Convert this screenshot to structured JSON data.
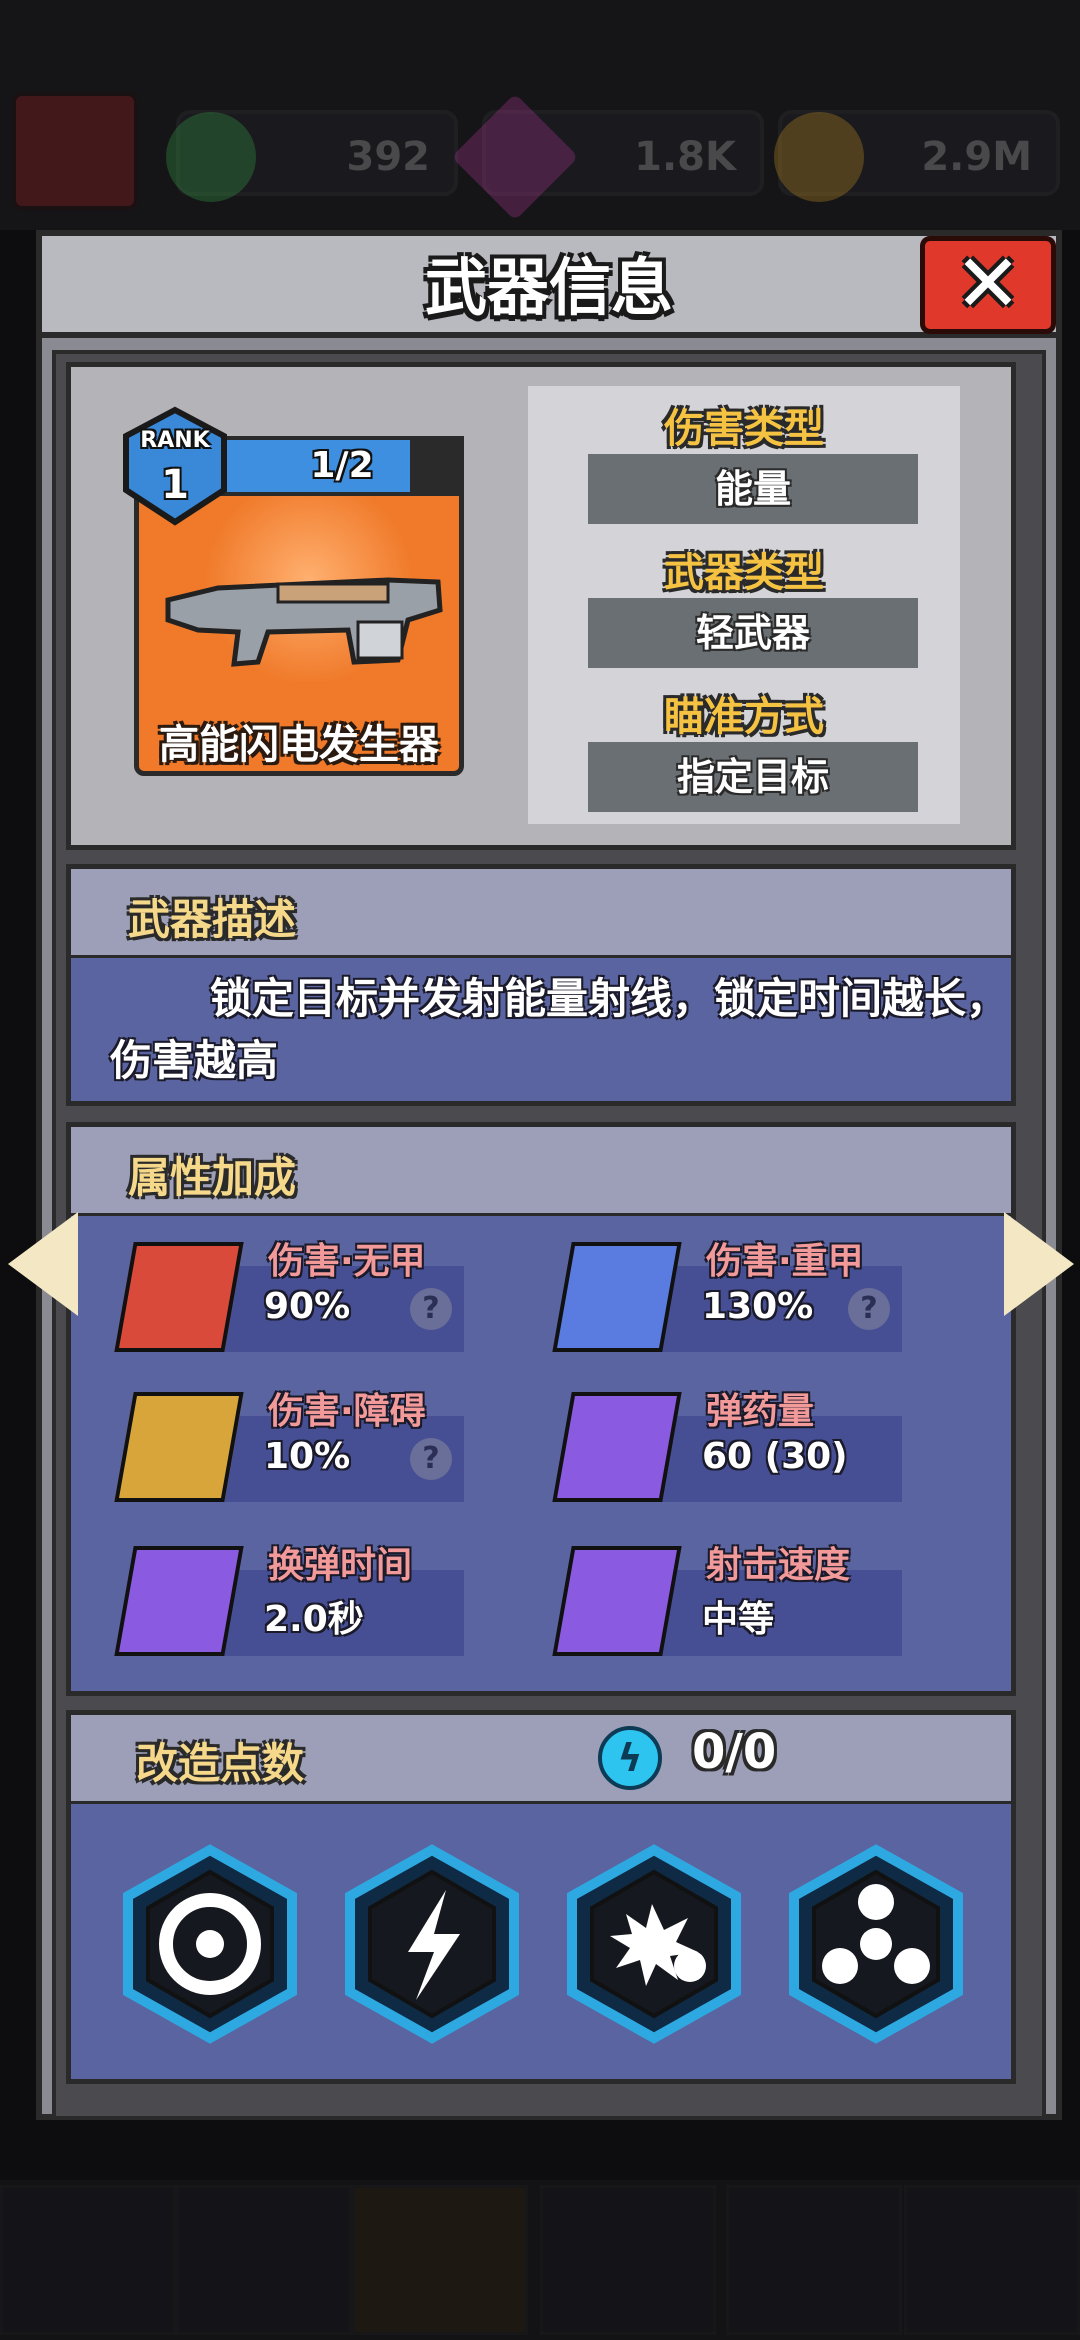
{
  "header": {
    "title": "武器信息",
    "close_label": "✕"
  },
  "resources": {
    "gems_green": "392",
    "gems_purple": "1.8K",
    "coins": "2.9M"
  },
  "weapon": {
    "rank_label": "RANK",
    "rank": "1",
    "level": "1/2",
    "level_fraction": 0.78,
    "name": "高能闪电发生器"
  },
  "info": {
    "damage_type_label": "伤害类型",
    "damage_type": "能量",
    "weapon_type_label": "武器类型",
    "weapon_type": "轻武器",
    "aim_label": "瞄准方式",
    "aim": "指定目标"
  },
  "description": {
    "heading": "武器描述",
    "text": "锁定目标并发射能量射线，锁定时间越长，伤害越高"
  },
  "attributes": {
    "heading": "属性加成",
    "items": [
      {
        "name": "伤害·无甲",
        "value": "90%",
        "icon": "target-icon",
        "color": "#d94a3a",
        "has_help": true
      },
      {
        "name": "伤害·重甲",
        "value": "130%",
        "icon": "shield-target-icon",
        "color": "#5a7be0",
        "has_help": true
      },
      {
        "name": "伤害·障碍",
        "value": "10%",
        "icon": "barrier-target-icon",
        "color": "#d8a53a",
        "has_help": true
      },
      {
        "name": "弹药量",
        "value": "60 (30)",
        "icon": "bullets-icon",
        "color": "#8a5ae0",
        "has_help": false
      },
      {
        "name": "换弹时间",
        "value": "2.0秒",
        "icon": "reload-icon",
        "color": "#8a5ae0",
        "has_help": false
      },
      {
        "name": "射击速度",
        "value": "中等",
        "icon": "fire-rate-icon",
        "color": "#8a5ae0",
        "has_help": false
      }
    ],
    "help_glyph": "?"
  },
  "mods": {
    "heading": "改造点数",
    "points": "0/0",
    "icons": [
      "trefoil-icon",
      "lightning-bolt-icon",
      "explosion-icon",
      "spinner-icon"
    ]
  },
  "colors": {
    "panel": "#8a8a93",
    "section_body": "#5a64a0",
    "accent_gold": "#f5c242",
    "close_red": "#e0392b",
    "hex_border": "#2ea8e0"
  }
}
